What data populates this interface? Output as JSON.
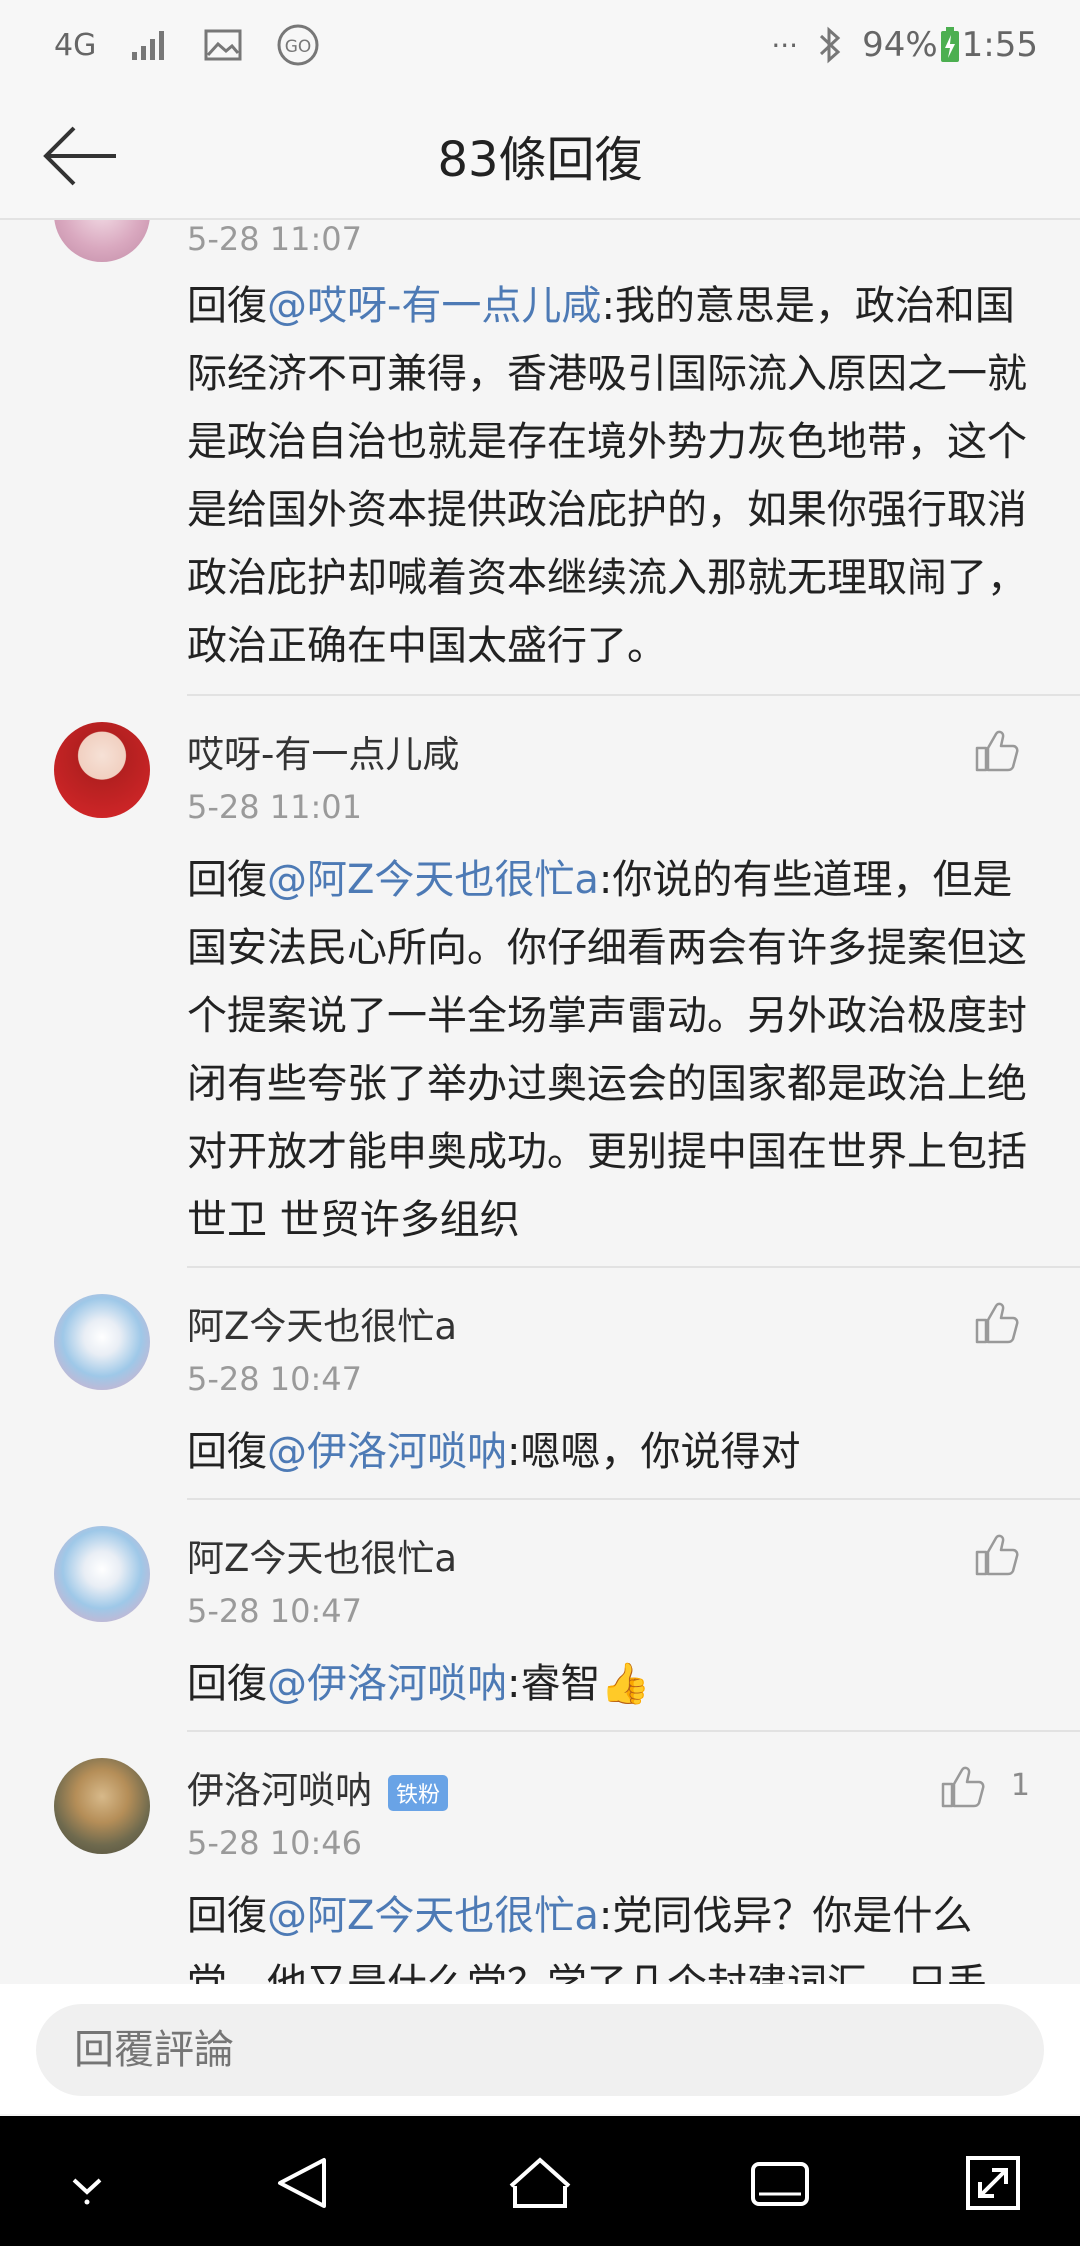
{
  "status_bar": {
    "network": "4G",
    "battery": "94%",
    "time": "1:55",
    "more": "···"
  },
  "header": {
    "title": "83條回復"
  },
  "comments": [
    {
      "time": "5-28 11:07",
      "reply_prefix": "回復",
      "mention": "@哎呀-有一点儿咸",
      "text": ":我的意思是，政治和国际经济不可兼得，香港吸引国际流入原因之一就是政治自治也就是存在境外势力灰色地带，这个是给国外资本提供政治庇护的，如果你强行取消政治庇护却喊着资本继续流入那就无理取闹了，政治正确在中国太盛行了。"
    },
    {
      "name": "哎呀-有一点儿咸",
      "time": "5-28 11:01",
      "reply_prefix": "回復",
      "mention": "@阿Z今天也很忙a",
      "text": ":你说的有些道理，但是国安法民心所向。你仔细看两会有许多提案但这个提案说了一半全场掌声雷动。另外政治极度封闭有些夸张了举办过奥运会的国家都是政治上绝对开放才能申奥成功。更别提中国在世界上包括世卫 世贸许多组织"
    },
    {
      "name": "阿Z今天也很忙a",
      "time": "5-28 10:47",
      "reply_prefix": "回復",
      "mention": "@伊洛河唢呐",
      "text": ":嗯嗯，你说得对"
    },
    {
      "name": "阿Z今天也很忙a",
      "time": "5-28 10:47",
      "reply_prefix": "回復",
      "mention": "@伊洛河唢呐",
      "text": ":睿智👍"
    },
    {
      "name": "伊洛河唢呐",
      "badge": "铁粉",
      "likes": "1",
      "time": "5-28 10:46",
      "reply_prefix": "回復",
      "mention": "@阿Z今天也很忙a",
      "text": ":党同伐异？你是什么党，他又是什么党？学了几个封建词汇，只丢"
    }
  ],
  "reply_bar": {
    "placeholder": "回覆評論"
  },
  "colors": {
    "mention": "#4d7ab5",
    "badge": "#69a3e6"
  },
  "icons": [
    "back-arrow-icon",
    "like-icon",
    "nav-down-icon",
    "nav-back-icon",
    "nav-home-icon",
    "nav-recent-icon",
    "nav-expand-icon"
  ]
}
